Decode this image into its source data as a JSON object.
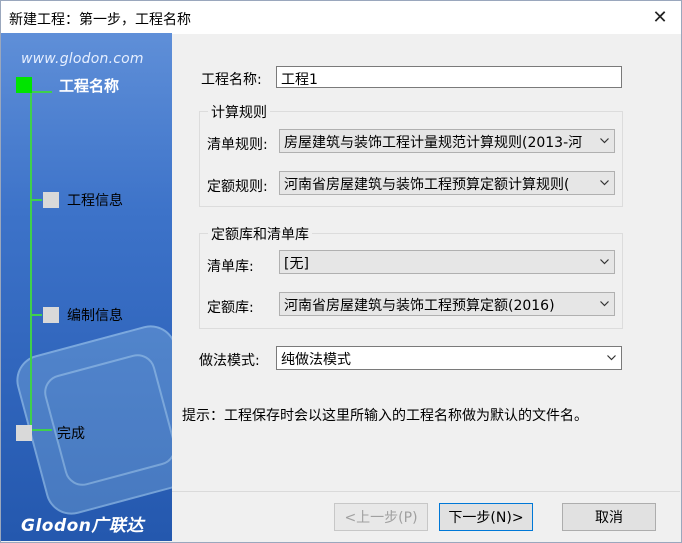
{
  "window": {
    "title": "新建工程：第一步，工程名称",
    "close_label": "✕"
  },
  "sidebar": {
    "brand_url": "www.glodon.com",
    "brand_logo": "Glodon广联达",
    "steps": [
      {
        "label": "工程名称",
        "active": true
      },
      {
        "label": "工程信息",
        "active": false
      },
      {
        "label": "编制信息",
        "active": false
      },
      {
        "label": "完成",
        "active": false
      }
    ],
    "colors": {
      "active_step": "#00e400",
      "connector": "#3fd04c",
      "inactive_step": "#d9d9d9",
      "panel": "#3d73c9"
    }
  },
  "form": {
    "project_name": {
      "label": "工程名称:",
      "value": "工程1"
    },
    "calc_rules": {
      "group_title": "计算规则",
      "bill_rule": {
        "label": "清单规则:",
        "value": "房屋建筑与装饰工程计量规范计算规则(2013-河"
      },
      "quota_rule": {
        "label": "定额规则:",
        "value": "河南省房屋建筑与装饰工程预算定额计算规则("
      }
    },
    "libraries": {
      "group_title": "定额库和清单库",
      "bill_lib": {
        "label": "清单库:",
        "value": "[无]"
      },
      "quota_lib": {
        "label": "定额库:",
        "value": "河南省房屋建筑与装饰工程预算定额(2016)"
      }
    },
    "method_mode": {
      "label": "做法模式:",
      "value": "纯做法模式"
    },
    "hint": "提示：工程保存时会以这里所输入的工程名称做为默认的文件名。"
  },
  "buttons": {
    "prev": "<上一步(P)",
    "next": "下一步(N)>",
    "cancel": "取消"
  }
}
